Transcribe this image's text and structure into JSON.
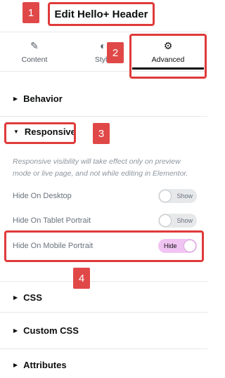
{
  "header": {
    "title": "Edit Hello+ Header"
  },
  "tabs": [
    {
      "label": "Content",
      "icon": "pencil-icon"
    },
    {
      "label": "Style",
      "icon": "contrast-icon"
    },
    {
      "label": "Advanced",
      "icon": "gear-icon",
      "active": true
    }
  ],
  "sections": {
    "behavior": "Behavior",
    "responsive": "Responsive",
    "css": "CSS",
    "custom_css": "Custom CSS",
    "attributes": "Attributes"
  },
  "responsive": {
    "note": "Responsive visibility will take effect only on preview mode or live page, and not while editing in Elementor.",
    "rows": [
      {
        "label": "Hide On Desktop",
        "toggle": "Show",
        "on": false
      },
      {
        "label": "Hide On Tablet Portrait",
        "toggle": "Show",
        "on": false
      },
      {
        "label": "Hide On Mobile Portrait",
        "toggle": "Hide",
        "on": true
      }
    ]
  },
  "annotations": {
    "badge1": "1",
    "badge2": "2",
    "badge3": "3",
    "badge4": "4"
  },
  "colors": {
    "annotation": "#e03a3a",
    "toggle_on": "#f0c4f2",
    "border": "#e6e8ea"
  }
}
